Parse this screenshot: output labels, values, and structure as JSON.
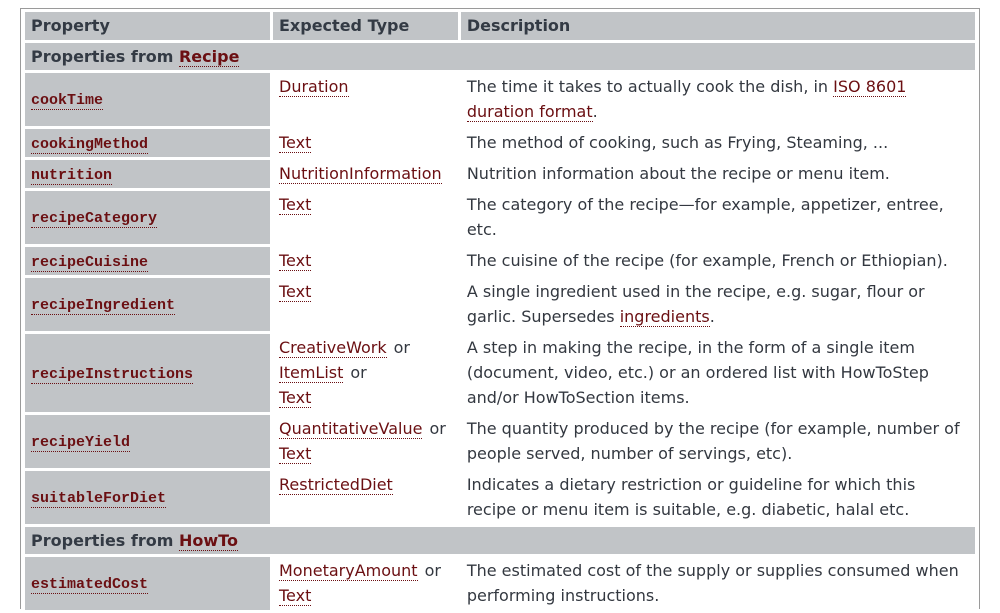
{
  "table": {
    "headers": [
      "Property",
      "Expected Type",
      "Description"
    ],
    "sections": [
      {
        "label_prefix": "Properties from",
        "label_link": "Recipe",
        "rows": [
          {
            "property": "cookTime",
            "types": [
              "Duration"
            ],
            "desc_parts": [
              {
                "text": "The time it takes to actually cook the dish, in "
              },
              {
                "link": "ISO 8601 duration format"
              },
              {
                "text": "."
              }
            ]
          },
          {
            "property": "cookingMethod",
            "types": [
              "Text"
            ],
            "desc_parts": [
              {
                "text": "The method of cooking, such as Frying, Steaming, ..."
              }
            ]
          },
          {
            "property": "nutrition",
            "types": [
              "NutritionInformation"
            ],
            "desc_parts": [
              {
                "text": "Nutrition information about the recipe or menu item."
              }
            ]
          },
          {
            "property": "recipeCategory",
            "types": [
              "Text"
            ],
            "desc_parts": [
              {
                "text": "The category of the recipe—for example, appetizer, entree, etc."
              }
            ]
          },
          {
            "property": "recipeCuisine",
            "types": [
              "Text"
            ],
            "desc_parts": [
              {
                "text": "The cuisine of the recipe (for example, French or Ethiopian)."
              }
            ]
          },
          {
            "property": "recipeIngredient",
            "types": [
              "Text"
            ],
            "desc_parts": [
              {
                "text": "A single ingredient used in the recipe, e.g. sugar, flour or garlic. Supersedes "
              },
              {
                "link": "ingredients"
              },
              {
                "text": "."
              }
            ]
          },
          {
            "property": "recipeInstructions",
            "types": [
              "CreativeWork",
              "ItemList",
              "Text"
            ],
            "desc_parts": [
              {
                "text": "A step in making the recipe, in the form of a single item (document, video, etc.) or an ordered list with HowToStep and/or HowToSection items."
              }
            ]
          },
          {
            "property": "recipeYield",
            "types": [
              "QuantitativeValue",
              "Text"
            ],
            "desc_parts": [
              {
                "text": "The quantity produced by the recipe (for example, number of people served, number of servings, etc)."
              }
            ]
          },
          {
            "property": "suitableForDiet",
            "types": [
              "RestrictedDiet"
            ],
            "desc_parts": [
              {
                "text": "Indicates a dietary restriction or guideline for which this recipe or menu item is suitable, e.g. diabetic, halal etc."
              }
            ]
          }
        ]
      },
      {
        "label_prefix": "Properties from",
        "label_link": "HowTo",
        "rows": [
          {
            "property": "estimatedCost",
            "types": [
              "MonetaryAmount",
              "Text"
            ],
            "desc_parts": [
              {
                "text": "The estimated cost of the supply or supplies consumed when performing instructions."
              }
            ]
          }
        ]
      }
    ],
    "or_label": "or"
  },
  "colors": {
    "header_bg": "#c1c4c7",
    "link": "#6b0f12",
    "text": "#333840"
  }
}
